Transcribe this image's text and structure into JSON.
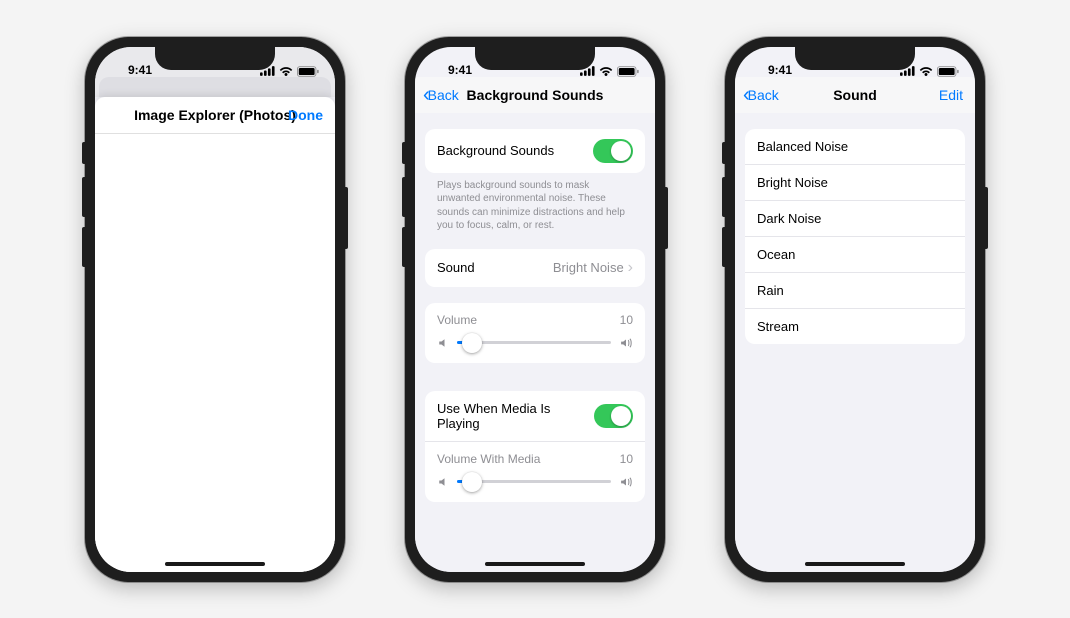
{
  "status": {
    "time": "9:41"
  },
  "phone1": {
    "bg_date_hint": "",
    "title": "Image Explorer (Photos)",
    "done": "Done"
  },
  "phone2": {
    "back": "Back",
    "title": "Background Sounds",
    "rows": {
      "bg_sounds_label": "Background Sounds",
      "bg_sounds_on": true,
      "description": "Plays background sounds to mask unwanted environmental noise. These sounds can minimize distractions and help you to focus, calm, or rest.",
      "sound_label": "Sound",
      "sound_value": "Bright Noise",
      "volume_label": "Volume",
      "volume_value": "10",
      "volume_pct": 10,
      "media_label": "Use When Media Is Playing",
      "media_on": true,
      "volume_media_label": "Volume With Media",
      "volume_media_value": "10",
      "volume_media_pct": 10
    }
  },
  "phone3": {
    "back": "Back",
    "title": "Sound",
    "edit": "Edit",
    "options": {
      "o1": "Balanced Noise",
      "o2": "Bright Noise",
      "o3": "Dark Noise",
      "o4": "Ocean",
      "o5": "Rain",
      "o6": "Stream"
    }
  }
}
